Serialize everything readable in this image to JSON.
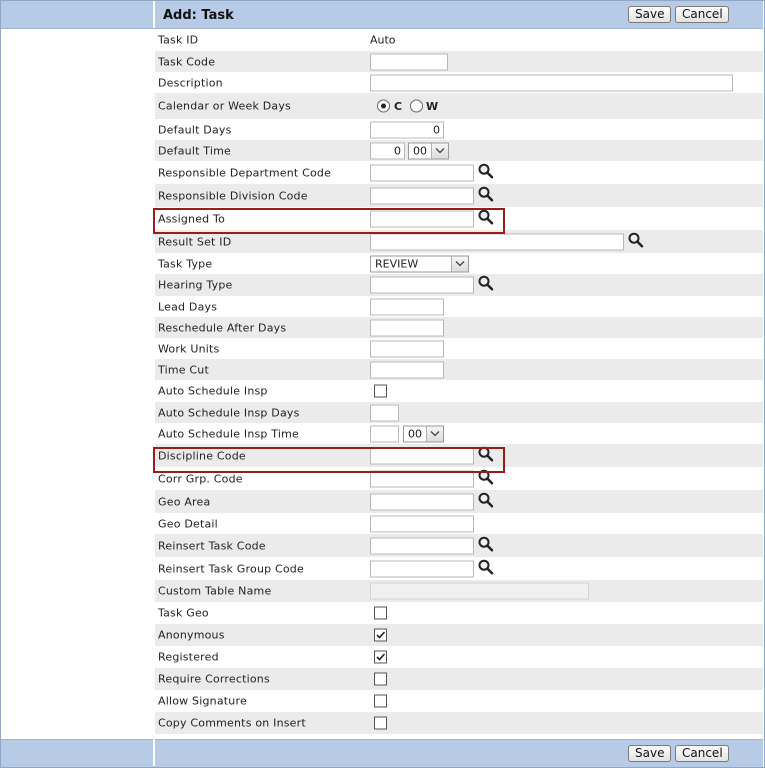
{
  "form": {
    "title": "Add: Task",
    "save_label": "Save",
    "cancel_label": "Cancel"
  },
  "fields": {
    "task_id": {
      "label": "Task ID",
      "value": "Auto"
    },
    "task_code": {
      "label": "Task Code",
      "value": ""
    },
    "description": {
      "label": "Description",
      "value": ""
    },
    "calendar": {
      "label": "Calendar or Week Days",
      "option_c": "C",
      "option_w": "W",
      "selected": "C"
    },
    "default_days": {
      "label": "Default Days",
      "value": "0"
    },
    "default_time": {
      "label": "Default Time",
      "hours": "0",
      "minutes": "00"
    },
    "resp_dept": {
      "label": "Responsible Department Code",
      "value": ""
    },
    "resp_div": {
      "label": "Responsible Division Code",
      "value": ""
    },
    "assigned_to": {
      "label": "Assigned To",
      "value": ""
    },
    "result_set": {
      "label": "Result Set ID",
      "value": ""
    },
    "task_type": {
      "label": "Task Type",
      "value": "REVIEW"
    },
    "hearing_type": {
      "label": "Hearing Type",
      "value": ""
    },
    "lead_days": {
      "label": "Lead Days",
      "value": ""
    },
    "reschedule": {
      "label": "Reschedule After Days",
      "value": ""
    },
    "work_units": {
      "label": "Work Units",
      "value": ""
    },
    "time_cut": {
      "label": "Time Cut",
      "value": ""
    },
    "auto_insp": {
      "label": "Auto Schedule Insp",
      "checked": false
    },
    "auto_insp_days": {
      "label": "Auto Schedule Insp Days",
      "value": ""
    },
    "auto_insp_time": {
      "label": "Auto Schedule Insp Time",
      "hours": "",
      "minutes": "00"
    },
    "discipline": {
      "label": "Discipline Code",
      "value": ""
    },
    "corr_grp": {
      "label": "Corr Grp. Code",
      "value": ""
    },
    "geo_area": {
      "label": "Geo Area",
      "value": ""
    },
    "geo_detail": {
      "label": "Geo Detail",
      "value": ""
    },
    "reinsert_task": {
      "label": "Reinsert Task Code",
      "value": ""
    },
    "reinsert_group": {
      "label": "Reinsert Task Group Code",
      "value": ""
    },
    "custom_table": {
      "label": "Custom Table Name",
      "value": ""
    },
    "task_geo": {
      "label": "Task Geo",
      "checked": false
    },
    "anonymous": {
      "label": "Anonymous",
      "checked": true
    },
    "registered": {
      "label": "Registered",
      "checked": true
    },
    "require_corr": {
      "label": "Require Corrections",
      "checked": false
    },
    "allow_sig": {
      "label": "Allow Signature",
      "checked": false
    },
    "copy_comments": {
      "label": "Copy Comments on Insert",
      "checked": false
    }
  },
  "colors": {
    "header_bar": "#b7cbe6",
    "alt_row": "#ebebeb",
    "highlight": "#9c1c1c"
  }
}
